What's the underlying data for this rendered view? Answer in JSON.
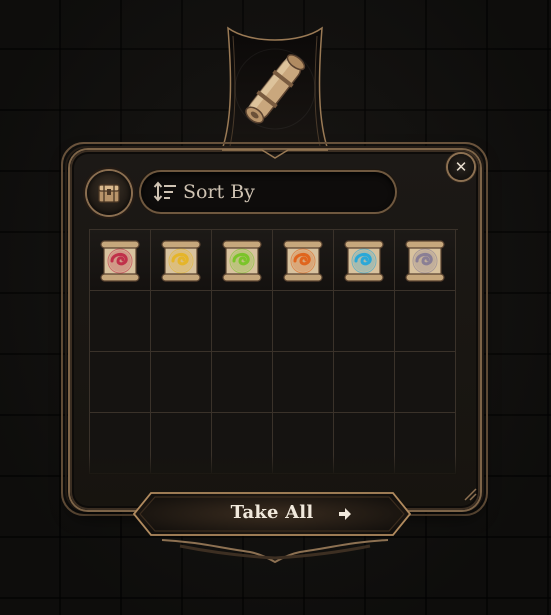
{
  "container": {
    "sort": {
      "label": "Sort By"
    },
    "take_all": {
      "label": "Take All"
    }
  },
  "grid": {
    "columns": 6,
    "rows": 4,
    "items": [
      {
        "name": "scroll-red-icon",
        "rune_color": "#c0304a"
      },
      {
        "name": "scroll-yellow-icon",
        "rune_color": "#e5b52a"
      },
      {
        "name": "scroll-green-icon",
        "rune_color": "#7bc42a"
      },
      {
        "name": "scroll-orange-icon",
        "rune_color": "#e0651e"
      },
      {
        "name": "scroll-blue-icon",
        "rune_color": "#2aa8d8"
      },
      {
        "name": "scroll-grey-icon",
        "rune_color": "#8a7f95"
      }
    ]
  },
  "colors": {
    "frame_gold": "#8d7152",
    "text": "#f1e9dc",
    "background": "#151412"
  }
}
